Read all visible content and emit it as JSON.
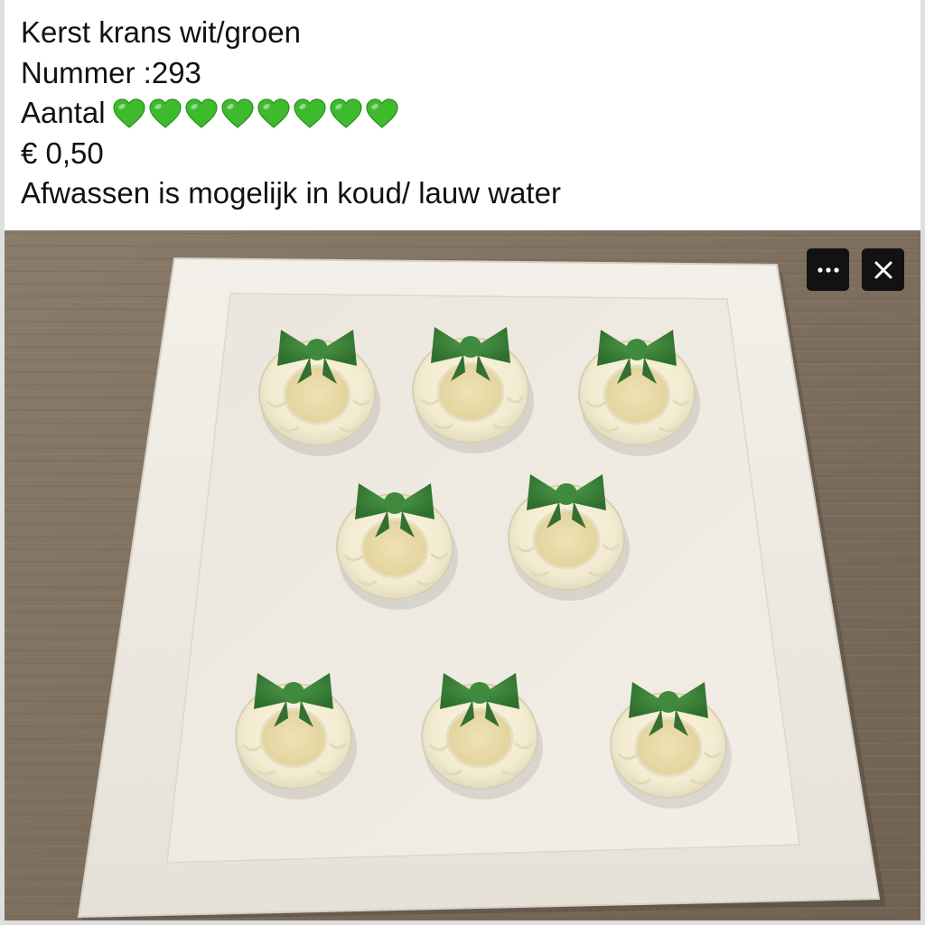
{
  "post": {
    "title_line": "Kerst krans wit/groen",
    "number_line": "Nummer :293",
    "quantity_label": "Aantal",
    "quantity_hearts": 8,
    "heart_icon": "green-heart-emoji",
    "price_line": "€ 0,50",
    "care_line": "Afwassen is mogelijk in koud/ lauw water"
  },
  "photo": {
    "subject": "product-photo",
    "wreath_count": 8
  },
  "viewer_controls": {
    "more_icon": "more-icon",
    "close_icon": "close-icon"
  },
  "colors": {
    "heart_green": "#3dbb2c",
    "button_bg": "#121212",
    "text": "#111111"
  }
}
